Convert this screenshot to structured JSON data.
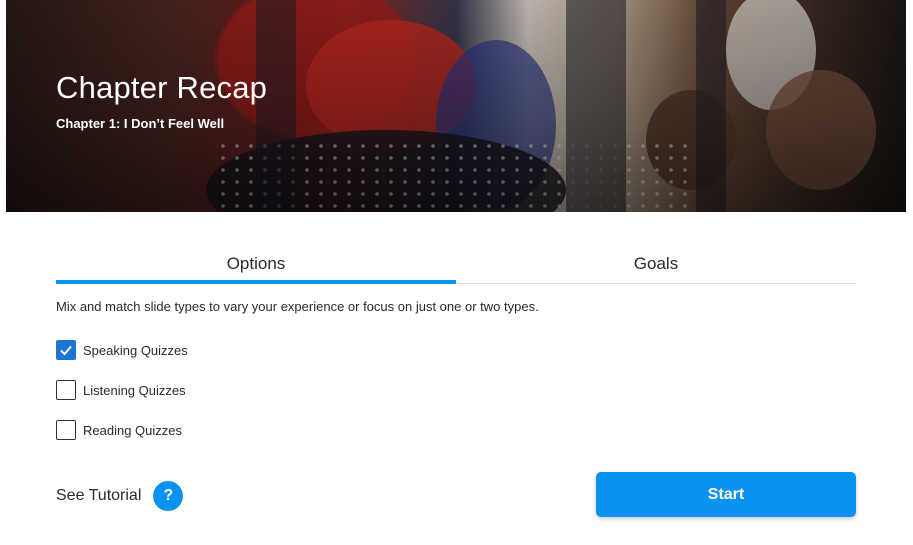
{
  "hero": {
    "title": "Chapter Recap",
    "subtitle": "Chapter 1: I Don’t Feel Well"
  },
  "tabs": [
    {
      "label": "Options",
      "active": true
    },
    {
      "label": "Goals",
      "active": false
    }
  ],
  "description": "Mix and match slide types to vary your experience or focus on just one or two types.",
  "options": [
    {
      "label": "Speaking Quizzes",
      "checked": true
    },
    {
      "label": "Listening Quizzes",
      "checked": false
    },
    {
      "label": "Reading Quizzes",
      "checked": false
    }
  ],
  "tutorial": {
    "label": "See Tutorial",
    "icon": "question-circle-icon",
    "icon_glyph": "?"
  },
  "start_button": {
    "label": "Start"
  },
  "colors": {
    "accent": "#0a92f0",
    "checkbox_checked": "#1976d2"
  }
}
